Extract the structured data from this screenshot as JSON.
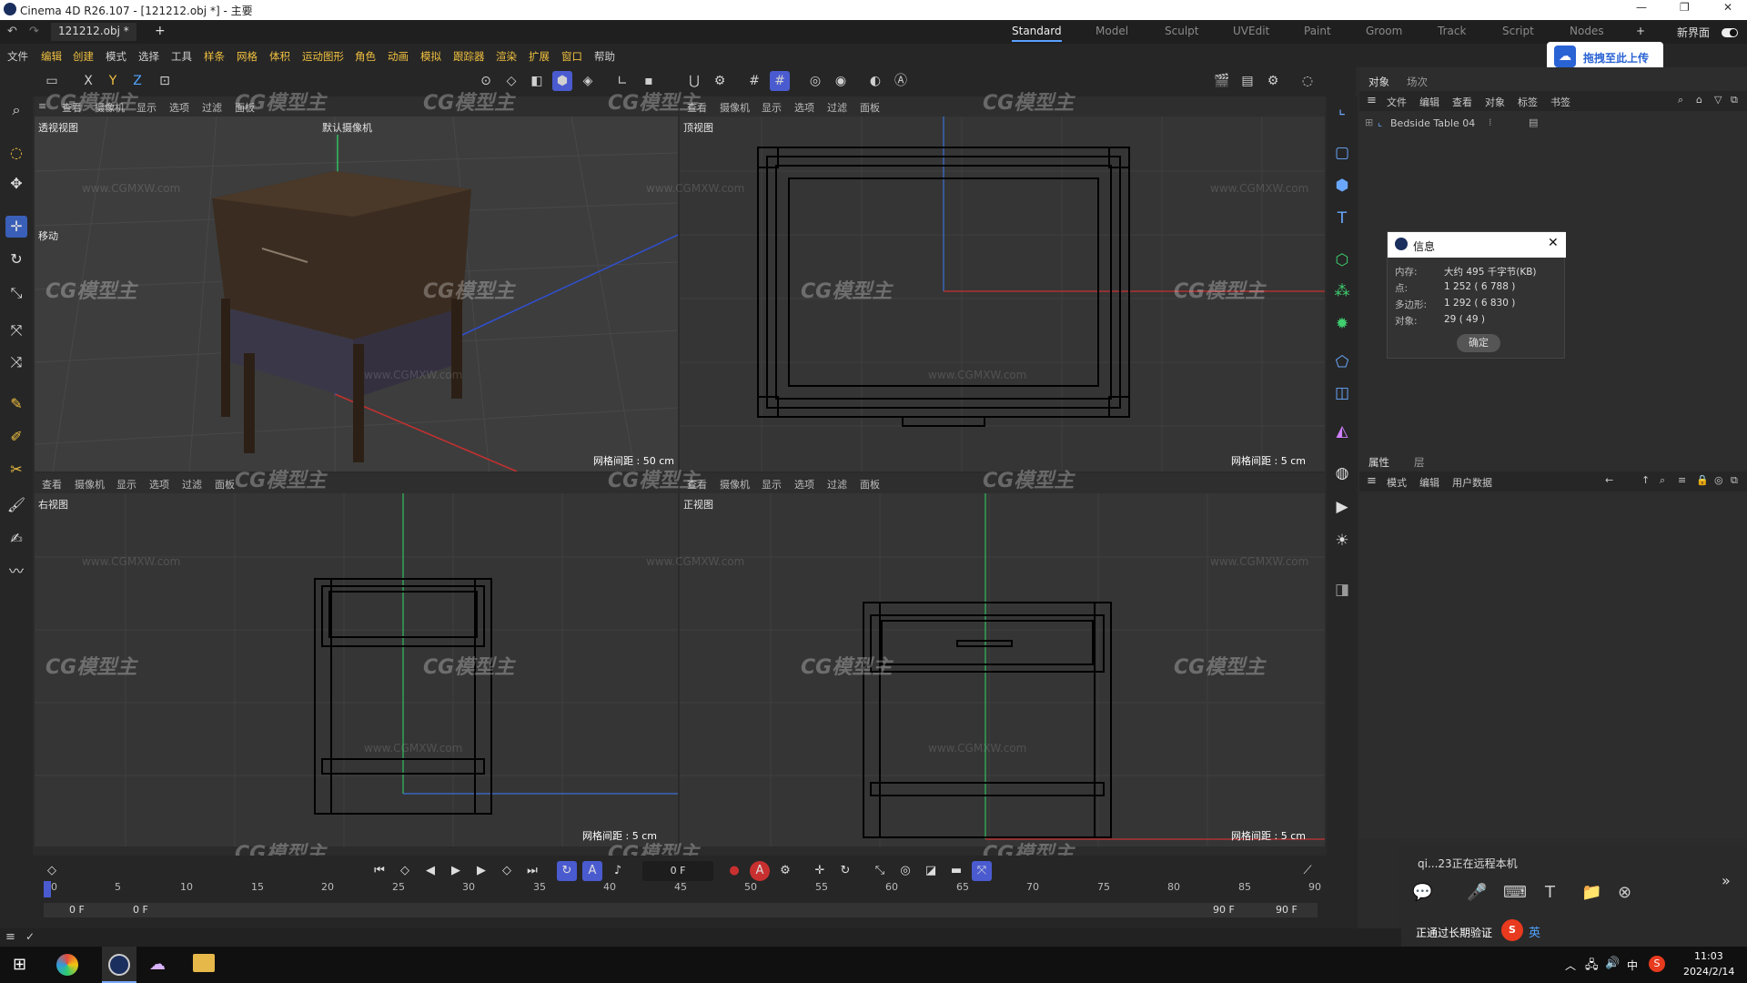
{
  "window": {
    "title": "Cinema 4D R26.107 - [121212.obj *] - 主要",
    "controls": [
      "—",
      "❐",
      "✕"
    ]
  },
  "tabs": {
    "doc": "121212.obj *",
    "add": "+"
  },
  "layouts": {
    "items": [
      "Standard",
      "Model",
      "Sculpt",
      "UVEdit",
      "Paint",
      "Groom",
      "Track",
      "Script",
      "Nodes"
    ],
    "active": "Standard",
    "add": "+",
    "new_ui": "新界面"
  },
  "menu": [
    "文件",
    "编辑",
    "创建",
    "模式",
    "选择",
    "工具",
    "样条",
    "网格",
    "体积",
    "运动图形",
    "角色",
    "动画",
    "模拟",
    "跟踪器",
    "渲染",
    "扩展",
    "窗口",
    "帮助"
  ],
  "upload": {
    "label": "拖拽至此上传"
  },
  "axes": {
    "x": "X",
    "y": "Y",
    "z": "Z"
  },
  "viewport_menu": [
    "查看",
    "摄像机",
    "显示",
    "选项",
    "过滤",
    "面板"
  ],
  "viewports": {
    "persp": {
      "name": "透视视图",
      "camera": "默认摄像机",
      "move": "移动",
      "grid": "网格间距 : 50 cm"
    },
    "top": {
      "name": "顶视图",
      "grid": "网格间距 : 5 cm"
    },
    "right": {
      "name": "右视图",
      "grid": "网格间距 : 5 cm"
    },
    "front": {
      "name": "正视图",
      "grid": "网格间距 : 5 cm"
    }
  },
  "watermark": {
    "logo": "CG模型主",
    "url": "www.CGMXW.com"
  },
  "object_panel": {
    "tabs": [
      "对象",
      "场次"
    ],
    "menu": [
      "文件",
      "编辑",
      "查看",
      "对象",
      "标签",
      "书签"
    ],
    "object": "Bedside Table 04"
  },
  "info_dialog": {
    "title": "信息",
    "rows": [
      {
        "label": "内存:",
        "value": "大约 495 千字节(KB)"
      },
      {
        "label": "点:",
        "value": "1 252 ( 6 788 )"
      },
      {
        "label": "多边形:",
        "value": "1 292 ( 6 830 )"
      },
      {
        "label": "对象:",
        "value": "29 ( 49 )"
      }
    ],
    "ok": "确定"
  },
  "attr_panel": {
    "tabs": [
      "属性",
      "层"
    ],
    "menu": [
      "模式",
      "编辑",
      "用户数据"
    ]
  },
  "timeline": {
    "frame": "0 F",
    "start": "0 F",
    "start2": "0 F",
    "end": "90 F",
    "end2": "90 F",
    "ticks": [
      "0",
      "5",
      "10",
      "15",
      "20",
      "25",
      "30",
      "35",
      "40",
      "45",
      "50",
      "55",
      "60",
      "65",
      "70",
      "75",
      "80",
      "85",
      "90"
    ]
  },
  "remote": {
    "user": "qi...23正在远程本机",
    "status": "正通过长期验证",
    "ime": "英"
  },
  "taskbar": {
    "time": "11:03",
    "date": "2024/2/14",
    "lang": "中"
  }
}
